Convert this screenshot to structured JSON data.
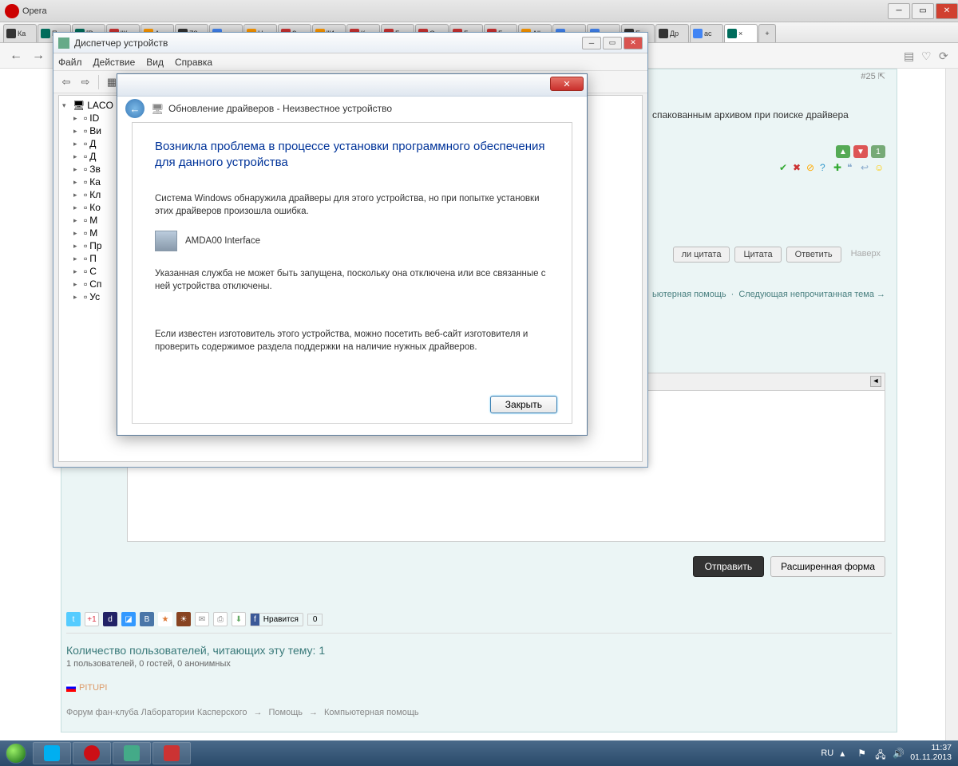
{
  "opera": {
    "label": "Opera"
  },
  "tabs": [
    {
      "label": "Ка",
      "fav": "m"
    },
    {
      "label": "Пе",
      "fav": "k"
    },
    {
      "label": "[P",
      "fav": "k"
    },
    {
      "label": "\"К",
      "fav": "r"
    },
    {
      "label": "Ал",
      "fav": "o"
    },
    {
      "label": "Z8",
      "fav": "m"
    },
    {
      "label": "пр",
      "fav": "g"
    },
    {
      "label": "Но",
      "fav": "o"
    },
    {
      "label": "Зл",
      "fav": "r"
    },
    {
      "label": "\"И",
      "fav": "o"
    },
    {
      "label": "Кр",
      "fav": "r"
    },
    {
      "label": "Бе",
      "fav": "r"
    },
    {
      "label": "Се",
      "fav": "r"
    },
    {
      "label": "Бо",
      "fav": "r"
    },
    {
      "label": "Бе",
      "fav": "r"
    },
    {
      "label": "All",
      "fav": "o"
    },
    {
      "label": "ев",
      "fav": "g"
    },
    {
      "label": "ер",
      "fav": "g"
    },
    {
      "label": "Ер",
      "fav": "m"
    },
    {
      "label": "Др",
      "fav": "m"
    },
    {
      "label": "ас",
      "fav": "g"
    },
    {
      "label": "×",
      "fav": "k",
      "active": true
    }
  ],
  "post": {
    "num": "#25",
    "text_fragment": "спакованным архивом при поиске драйвера",
    "vote_count": "1",
    "btn_multiquote": "ли цитата",
    "btn_quote": "Цитата",
    "btn_reply": "Ответить",
    "link_top": "Наверх"
  },
  "crumbs_mid": {
    "a": "ьютерная помощь",
    "b": "Следующая непрочитанная тема →"
  },
  "reply": {
    "toggle": "◄",
    "send": "Отправить",
    "advanced": "Расширенная форма"
  },
  "share": {
    "fb_like": "Нравится",
    "fb_count": "0"
  },
  "readers": {
    "title": "Количество пользователей, читающих эту тему: 1",
    "sub": "1 пользователей, 0 гостей, 0 анонимных",
    "user": "PITUPI"
  },
  "bottom_crumbs": [
    "Форум фан-клуба Лаборатории Касперского",
    "Помощь",
    "Компьютерная помощь"
  ],
  "devmgr": {
    "title": "Диспетчер устройств",
    "menu": [
      "Файл",
      "Действие",
      "Вид",
      "Справка"
    ],
    "root": "LACO",
    "items": [
      "ID",
      "Ви",
      "Д",
      "Д",
      "Зв",
      "Ка",
      "Кл",
      "Ко",
      "М",
      "М",
      "Пр",
      "П",
      "С",
      "Сп",
      "Ус"
    ]
  },
  "dialog": {
    "header": "Обновление драйверов - Неизвестное устройство",
    "h1": "Возникла проблема в процессе установки программного обеспечения для данного устройства",
    "p1": "Система Windows обнаружила драйверы для этого устройства, но при попытке установки этих драйверов произошла ошибка.",
    "device": "AMDA00 Interface",
    "p2": "Указанная служба не может быть запущена, поскольку она отключена или все связанные с ней устройства отключены.",
    "p3": "Если известен изготовитель этого устройства, можно посетить веб-сайт изготовителя и проверить содержимое раздела поддержки на наличие нужных драйверов.",
    "close_btn": "Закрыть"
  },
  "taskbar": {
    "lang": "RU",
    "time": "11:37",
    "date": "01.11.2013"
  }
}
